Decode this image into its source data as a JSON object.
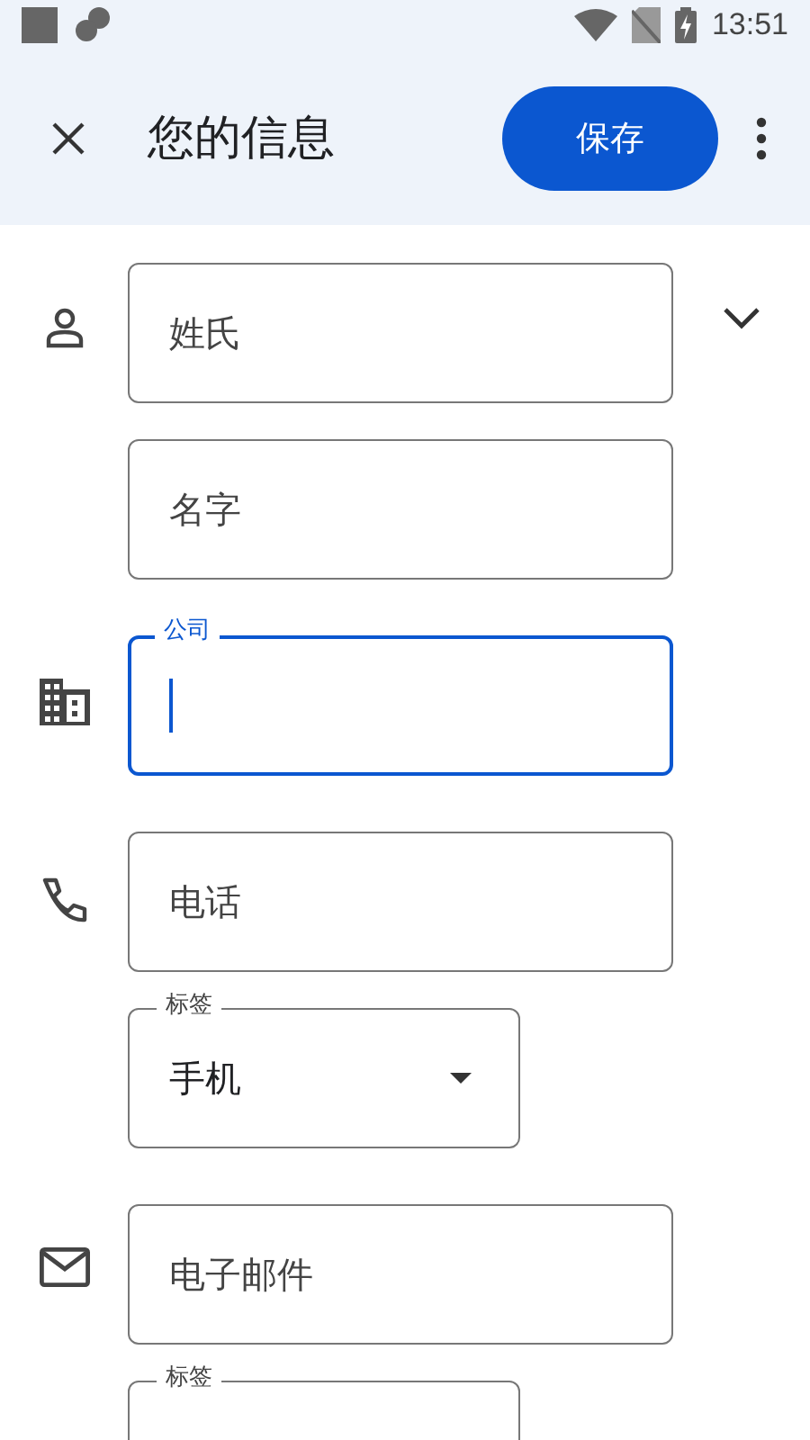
{
  "status_bar": {
    "time": "13:51"
  },
  "toolbar": {
    "title": "您的信息",
    "save_label": "保存"
  },
  "sections": [
    {
      "kind": "name",
      "expanded": false,
      "fields": [
        {
          "kind": "text",
          "placeholder": "姓氏",
          "focused": false
        },
        {
          "kind": "text",
          "placeholder": "名字",
          "focused": false
        }
      ]
    },
    {
      "kind": "company",
      "fields": [
        {
          "kind": "text",
          "label": "公司",
          "focused": true
        }
      ]
    },
    {
      "kind": "phone",
      "fields": [
        {
          "kind": "text",
          "placeholder": "电话",
          "focused": false
        },
        {
          "kind": "dropdown",
          "label": "标签",
          "value": "手机"
        }
      ]
    },
    {
      "kind": "email",
      "fields": [
        {
          "kind": "text",
          "placeholder": "电子邮件",
          "focused": false
        },
        {
          "kind": "dropdown",
          "label": "标签"
        }
      ]
    }
  ]
}
